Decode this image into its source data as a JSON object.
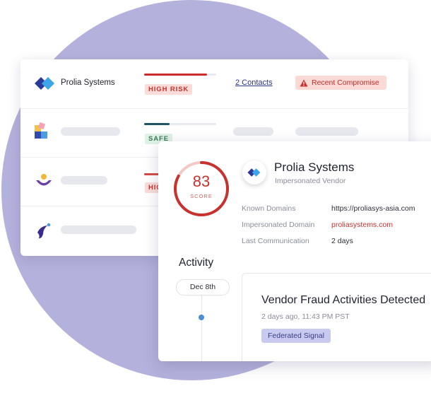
{
  "vendors": [
    {
      "name": "Proliasys Logo",
      "display_name": "Prolia Systems",
      "risk_label": "HIGH RISK",
      "risk_fill": 0.87,
      "risk_color": "#cc2a28",
      "contacts": "2 Contacts",
      "alert": "Recent Compromise"
    },
    {
      "risk_label": "SAFE",
      "risk_fill": 0.35,
      "risk_color": "#1e5560"
    },
    {
      "risk_label": "HIG",
      "risk_color": "#d24a47"
    },
    {}
  ],
  "detail": {
    "score": "83",
    "score_label": "SCORE",
    "score_fraction": 0.83,
    "vendor_name": "Prolia Systems",
    "vendor_subtitle": "Impersonated Vendor",
    "info": [
      {
        "label": "Known Domains",
        "value": "https://proliasys-asia.com"
      },
      {
        "label": "Impersonated Domain",
        "value": "proliasystems.com"
      },
      {
        "label": "Last Communication",
        "value": "2 days"
      }
    ]
  },
  "activity": {
    "heading": "Activity",
    "date": "Dec 8th",
    "event_title": "Vendor Fraud Activities Detected",
    "event_time": "2 days ago, 11:43 PM PST",
    "tag": "Federated Signal"
  },
  "colors": {
    "background_circle": "#b4b2dc",
    "risk_red": "#c8322e",
    "safe_teal": "#1e5560",
    "accent_blue": "#4a8fd4"
  }
}
